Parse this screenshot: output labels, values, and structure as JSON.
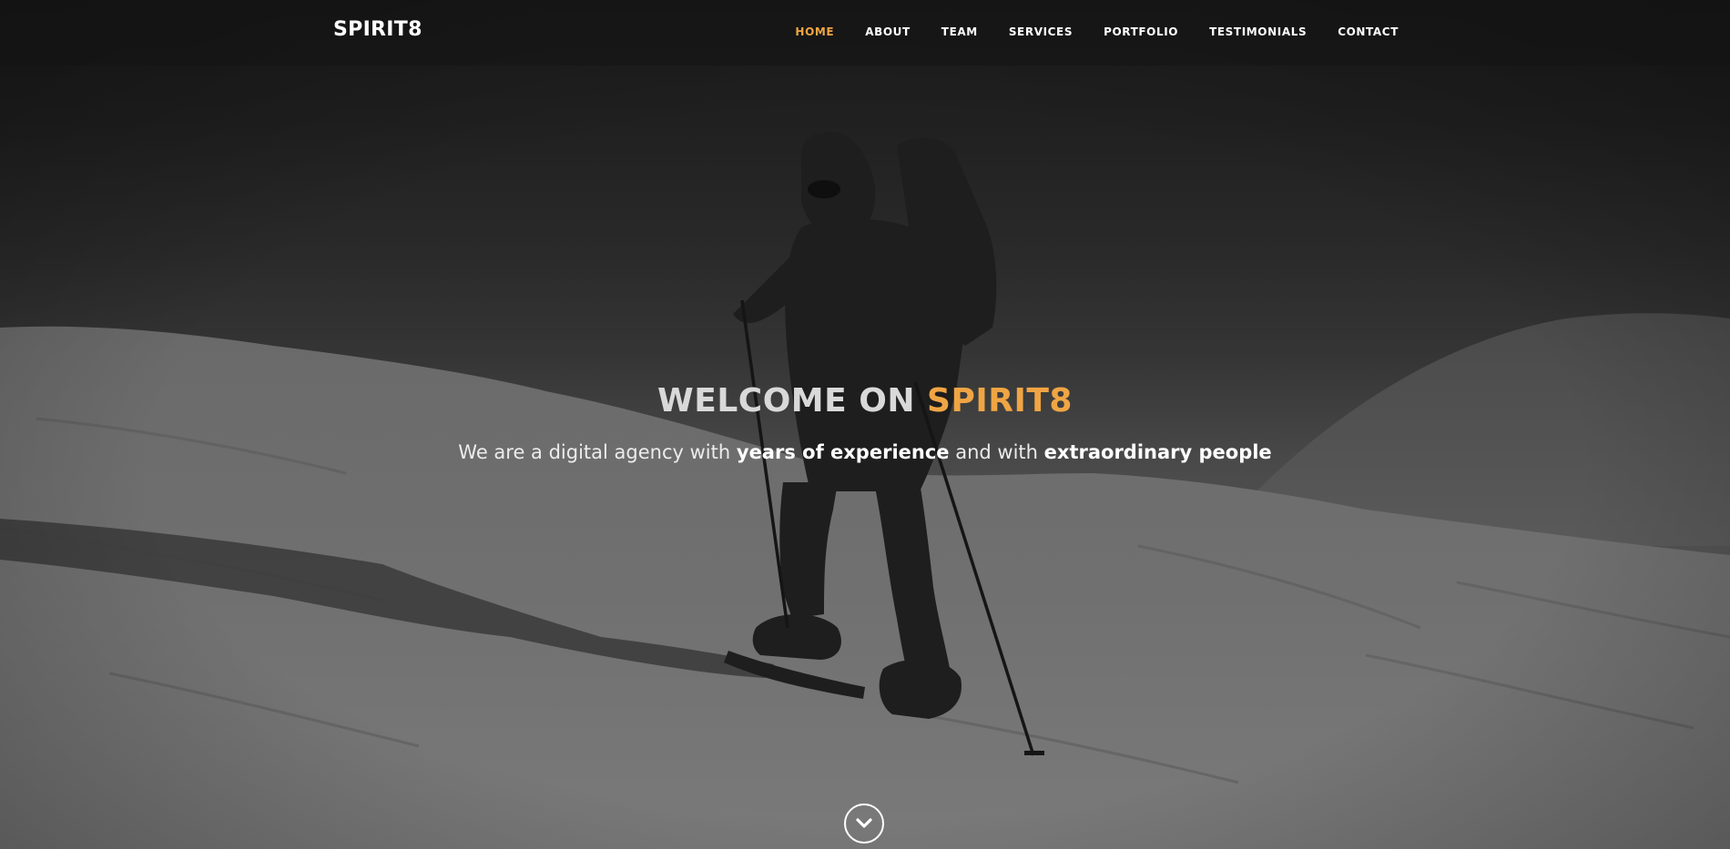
{
  "brand": {
    "name": "SPIRIT8"
  },
  "nav": {
    "items": [
      {
        "label": "HOME",
        "active": true
      },
      {
        "label": "ABOUT",
        "active": false
      },
      {
        "label": "TEAM",
        "active": false
      },
      {
        "label": "SERVICES",
        "active": false
      },
      {
        "label": "PORTFOLIO",
        "active": false
      },
      {
        "label": "TESTIMONIALS",
        "active": false
      },
      {
        "label": "CONTACT",
        "active": false
      }
    ]
  },
  "hero": {
    "title_prefix": "WELCOME ON",
    "title_accent": "SPIRIT8",
    "sub_part1": "We are a digital agency with",
    "sub_bold1": "years of experience",
    "sub_part2": "and with",
    "sub_bold2": "extraordinary people",
    "background_image": "snow-hiker-icon",
    "scroll_icon": "chevron-down-icon"
  },
  "colors": {
    "accent": "#f0a544",
    "text": "#ffffff"
  }
}
